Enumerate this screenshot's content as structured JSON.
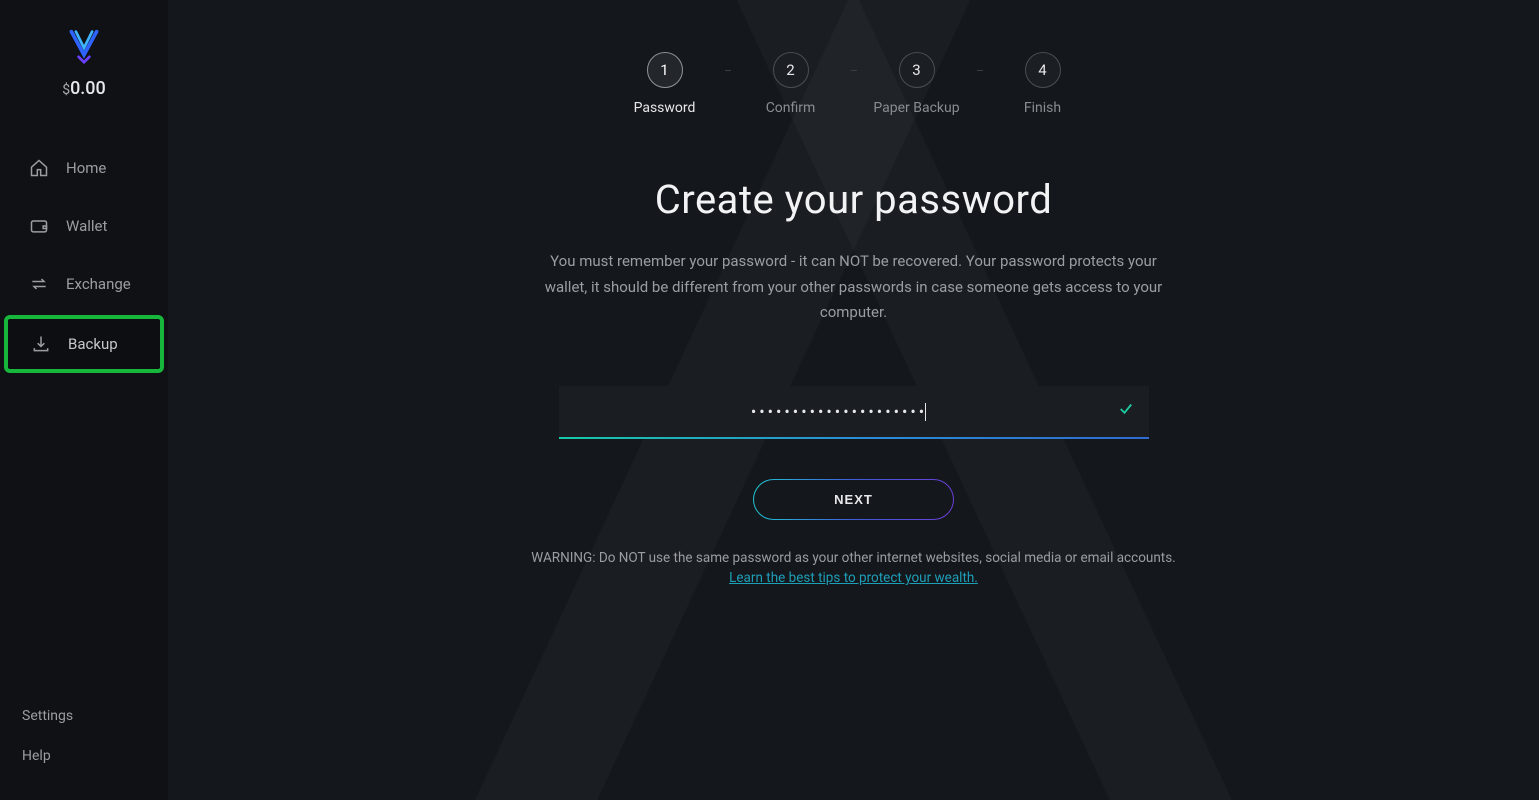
{
  "sidebar": {
    "balance_symbol": "$",
    "balance_value": "0.00",
    "items": [
      {
        "label": "Home",
        "icon": "home-icon"
      },
      {
        "label": "Wallet",
        "icon": "wallet-icon"
      },
      {
        "label": "Exchange",
        "icon": "exchange-icon"
      },
      {
        "label": "Backup",
        "icon": "backup-icon",
        "active": true
      }
    ],
    "bottom": [
      {
        "label": "Settings"
      },
      {
        "label": "Help"
      }
    ]
  },
  "steps": [
    {
      "num": "1",
      "label": "Password",
      "current": true
    },
    {
      "num": "2",
      "label": "Confirm"
    },
    {
      "num": "3",
      "label": "Paper Backup"
    },
    {
      "num": "4",
      "label": "Finish"
    }
  ],
  "page": {
    "title": "Create your password",
    "description": "You must remember your password - it can NOT be recovered. Your password protects your wallet, it should be different from your other passwords in case someone gets access to your computer.",
    "password_mask": "•••••••••••••••••••••",
    "next_label": "NEXT",
    "warning": "WARNING: Do NOT use the same password as your other internet websites, social media or email accounts.",
    "tips_link": "Learn the best tips to protect your wealth."
  }
}
